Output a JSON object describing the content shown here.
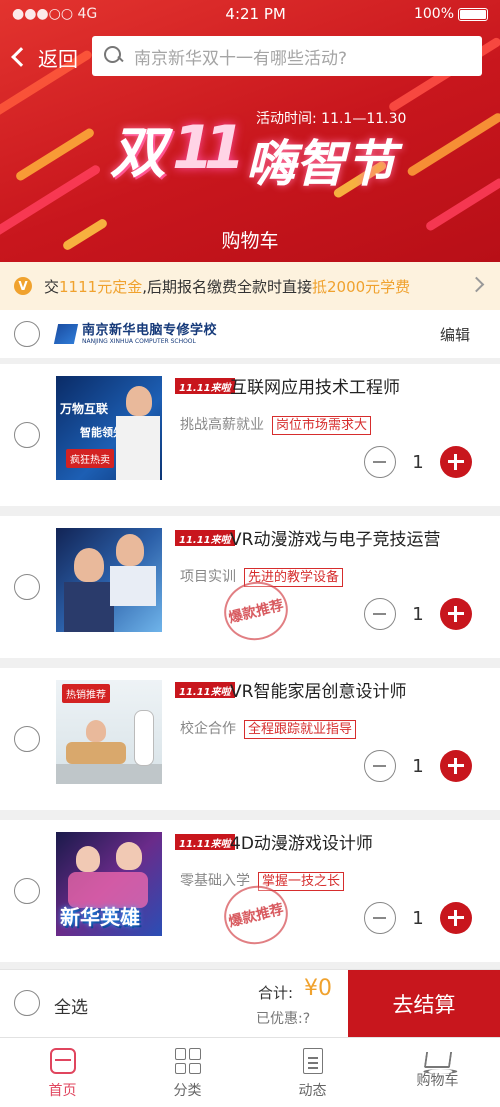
{
  "status": {
    "carrier": "●●●○○ 4G",
    "time": "4:21 PM",
    "battery": "100%"
  },
  "header": {
    "back_label": "返回",
    "search_placeholder": "南京新华双十一有哪些活动?",
    "banner_title_a": "双",
    "banner_title_b": "11",
    "banner_title_c": "嗨智节",
    "activity_time": "活动时间: 11.1—11.30",
    "page_title": "购物车"
  },
  "notice": {
    "badge": "V",
    "pre": "交",
    "deposit": "1111元定金",
    "mid": ",后期报名缴费全款时直接",
    "reward": "抵2000元学费"
  },
  "store": {
    "name_cn": "南京新华电脑专修学校",
    "name_en": "NANJING XINHUA COMPUTER SCHOOL",
    "edit_label": "编辑"
  },
  "promo_tag": "11.11来啦",
  "items": [
    {
      "title": "互联网应用技术工程师",
      "feature": "挑战高薪就业",
      "badge": "岗位市场需求大",
      "qty": "1",
      "thumb_text": "万物互联",
      "thumb_sub": "智能领先",
      "thumb_label": "疯狂热卖"
    },
    {
      "title": "VR动漫游戏与电子竞技运营",
      "feature": "项目实训",
      "badge": "先进的教学设备",
      "qty": "1",
      "stamp": "爆款推荐"
    },
    {
      "title": "VR智能家居创意设计师",
      "feature": "校企合作",
      "badge": "全程跟踪就业指导",
      "qty": "1",
      "thumb_label": "热销推荐"
    },
    {
      "title": "4D动漫游戏设计师",
      "feature": "零基础入学",
      "badge": "掌握一技之长",
      "qty": "1",
      "stamp": "爆款推荐",
      "thumb_text": "新华英雄"
    }
  ],
  "checkout": {
    "select_all": "全选",
    "total_label": "合计:",
    "total_value": "¥0",
    "discount": "已优惠:?",
    "button": "去结算"
  },
  "tabs": [
    {
      "label": "首页",
      "icon": "home-icon"
    },
    {
      "label": "分类",
      "icon": "grid-icon"
    },
    {
      "label": "动态",
      "icon": "doc-icon"
    },
    {
      "label": "购物车",
      "icon": "cart-icon"
    }
  ],
  "colors": {
    "brand_red": "#c8161d",
    "accent_orange": "#f0a22e",
    "tab_active": "#e0455e"
  }
}
